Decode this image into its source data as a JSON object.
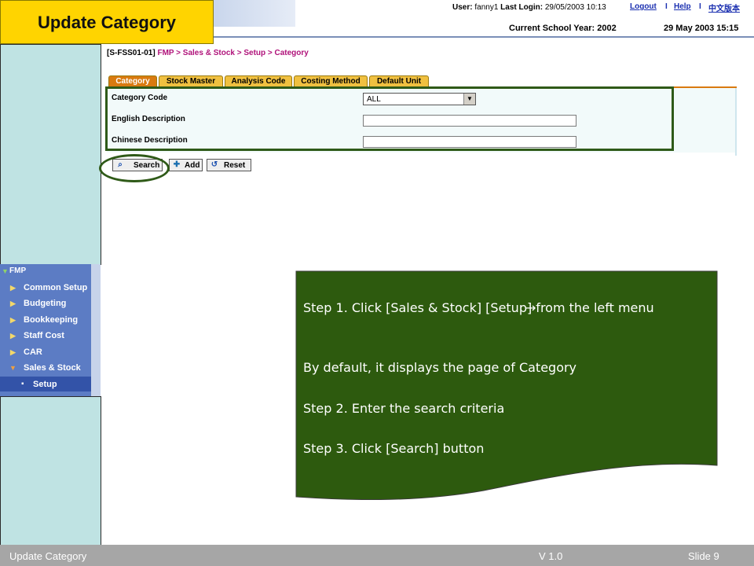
{
  "header": {
    "title": "Update Category",
    "user_label": "User:",
    "user_name": "fanny1",
    "last_login_label": "Last Login:",
    "last_login_value": "29/05/2003 10:13",
    "logout_link": "Logout",
    "separator": "I",
    "help_link": "Help",
    "chinese_link": "中文版本",
    "school_year": "Current School Year: 2002",
    "datetime": "29 May 2003 15:15"
  },
  "breadcrumb": {
    "code": "[S-FSS01-01]",
    "trail": "FMP > Sales & Stock > Setup > Category"
  },
  "tabs": [
    {
      "label": "Category",
      "active": true
    },
    {
      "label": "Stock Master",
      "active": false
    },
    {
      "label": "Analysis Code",
      "active": false
    },
    {
      "label": "Costing Method",
      "active": false
    },
    {
      "label": "Default Unit",
      "active": false
    }
  ],
  "form": {
    "category_code_label": "Category Code",
    "category_code_value": "ALL",
    "english_label": "English Description",
    "english_value": "",
    "chinese_label": "Chinese Description",
    "chinese_value": ""
  },
  "buttons": {
    "search": "Search",
    "add": "Add",
    "reset": "Reset"
  },
  "nav": {
    "root": "FMP",
    "items": [
      {
        "label": "Common Setup"
      },
      {
        "label": "Budgeting"
      },
      {
        "label": "Bookkeeping"
      },
      {
        "label": "Staff Cost"
      },
      {
        "label": "CAR"
      },
      {
        "label": "Sales & Stock"
      },
      {
        "label": "Setup"
      }
    ]
  },
  "callout": {
    "step1": "Step 1. Click [Sales & Stock]  [Setup] from the left menu",
    "step1_arrow": "→",
    "line2": "By default, it displays the page of Category",
    "step2": "Step 2. Enter the search criteria",
    "step3": "Step 3. Click [Search] button"
  },
  "footer": {
    "title": "Update Category",
    "version": "V 1.0",
    "slide": "Slide 9"
  },
  "colors": {
    "title_yellow": "#ffd400",
    "callout_green": "#2d5a0e",
    "tab_orange": "#d97a10",
    "tab_gold": "#f0c040",
    "nav_blue": "#5c7cc4",
    "link_blue": "#1a2fb0",
    "crumb_magenta": "#b0127a",
    "panel_cyan": "#bfe3e3"
  }
}
